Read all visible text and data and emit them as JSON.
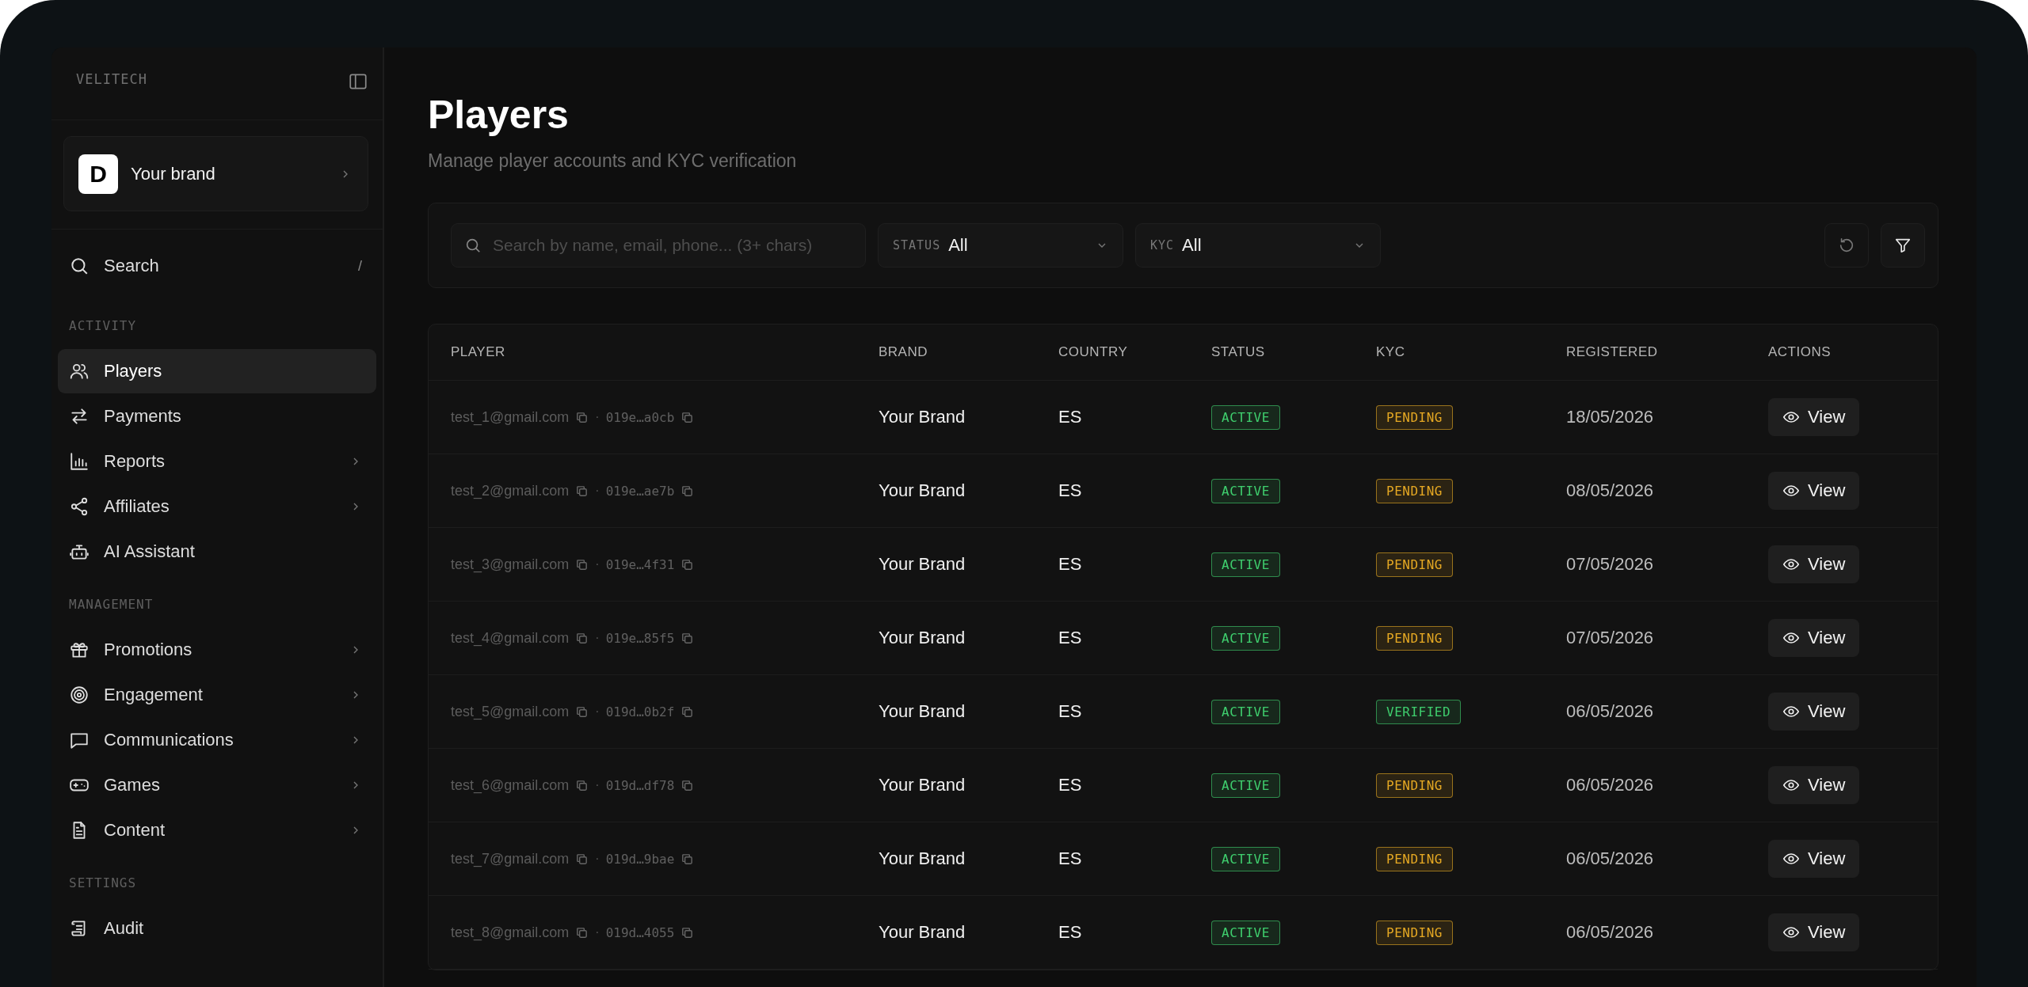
{
  "sidebar": {
    "logo": "VELITECH",
    "brand": {
      "initial": "D",
      "name": "Your brand"
    },
    "search": {
      "label": "Search",
      "shortcut": "/"
    },
    "sections": [
      {
        "heading": "ACTIVITY",
        "items": [
          {
            "label": "Players",
            "selected": true,
            "submenu": false
          },
          {
            "label": "Payments",
            "selected": false,
            "submenu": false
          },
          {
            "label": "Reports",
            "selected": false,
            "submenu": true
          },
          {
            "label": "Affiliates",
            "selected": false,
            "submenu": true
          },
          {
            "label": "AI Assistant",
            "selected": false,
            "submenu": false
          }
        ]
      },
      {
        "heading": "MANAGEMENT",
        "items": [
          {
            "label": "Promotions",
            "selected": false,
            "submenu": true
          },
          {
            "label": "Engagement",
            "selected": false,
            "submenu": true
          },
          {
            "label": "Communications",
            "selected": false,
            "submenu": true
          },
          {
            "label": "Games",
            "selected": false,
            "submenu": true
          },
          {
            "label": "Content",
            "selected": false,
            "submenu": true
          }
        ]
      },
      {
        "heading": "SETTINGS",
        "items": [
          {
            "label": "Audit",
            "selected": false,
            "submenu": false
          }
        ]
      }
    ]
  },
  "page": {
    "title": "Players",
    "subtitle": "Manage player accounts and KYC verification"
  },
  "filters": {
    "search": {
      "placeholder": "Search by name, email, phone... (3+ chars)"
    },
    "selects": [
      {
        "label": "STATUS",
        "value": "All"
      },
      {
        "label": "KYC",
        "value": "All"
      }
    ]
  },
  "table": {
    "columns": [
      "PLAYER",
      "BRAND",
      "COUNTRY",
      "STATUS",
      "KYC",
      "REGISTERED",
      "ACTIONS"
    ],
    "rows": [
      {
        "email": "test_1@gmail.com",
        "separator": "·",
        "id": "019e…a0cb",
        "brand": "Your Brand",
        "country": "ES",
        "status": {
          "label": "ACTIVE",
          "color": "#3fcf6e"
        },
        "kyc": {
          "label": "PENDING",
          "color": "#e5a823"
        },
        "registered": "18/05/2026",
        "action": "View"
      },
      {
        "email": "test_2@gmail.com",
        "separator": "·",
        "id": "019e…ae7b",
        "brand": "Your Brand",
        "country": "ES",
        "status": {
          "label": "ACTIVE",
          "color": "#3fcf6e"
        },
        "kyc": {
          "label": "PENDING",
          "color": "#e5a823"
        },
        "registered": "08/05/2026",
        "action": "View"
      },
      {
        "email": "test_3@gmail.com",
        "separator": "·",
        "id": "019e…4f31",
        "brand": "Your Brand",
        "country": "ES",
        "status": {
          "label": "ACTIVE",
          "color": "#3fcf6e"
        },
        "kyc": {
          "label": "PENDING",
          "color": "#e5a823"
        },
        "registered": "07/05/2026",
        "action": "View"
      },
      {
        "email": "test_4@gmail.com",
        "separator": "·",
        "id": "019e…85f5",
        "brand": "Your Brand",
        "country": "ES",
        "status": {
          "label": "ACTIVE",
          "color": "#3fcf6e"
        },
        "kyc": {
          "label": "PENDING",
          "color": "#e5a823"
        },
        "registered": "07/05/2026",
        "action": "View"
      },
      {
        "email": "test_5@gmail.com",
        "separator": "·",
        "id": "019d…0b2f",
        "brand": "Your Brand",
        "country": "ES",
        "status": {
          "label": "ACTIVE",
          "color": "#3fcf6e"
        },
        "kyc": {
          "label": "VERIFIED",
          "color": "#3fcf6e"
        },
        "registered": "06/05/2026",
        "action": "View"
      },
      {
        "email": "test_6@gmail.com",
        "separator": "·",
        "id": "019d…df78",
        "brand": "Your Brand",
        "country": "ES",
        "status": {
          "label": "ACTIVE",
          "color": "#3fcf6e"
        },
        "kyc": {
          "label": "PENDING",
          "color": "#e5a823"
        },
        "registered": "06/05/2026",
        "action": "View"
      },
      {
        "email": "test_7@gmail.com",
        "separator": "·",
        "id": "019d…9bae",
        "brand": "Your Brand",
        "country": "ES",
        "status": {
          "label": "ACTIVE",
          "color": "#3fcf6e"
        },
        "kyc": {
          "label": "PENDING",
          "color": "#e5a823"
        },
        "registered": "06/05/2026",
        "action": "View"
      },
      {
        "email": "test_8@gmail.com",
        "separator": "·",
        "id": "019d…4055",
        "brand": "Your Brand",
        "country": "ES",
        "status": {
          "label": "ACTIVE",
          "color": "#3fcf6e"
        },
        "kyc": {
          "label": "PENDING",
          "color": "#e5a823"
        },
        "registered": "06/05/2026",
        "action": "View"
      }
    ]
  }
}
